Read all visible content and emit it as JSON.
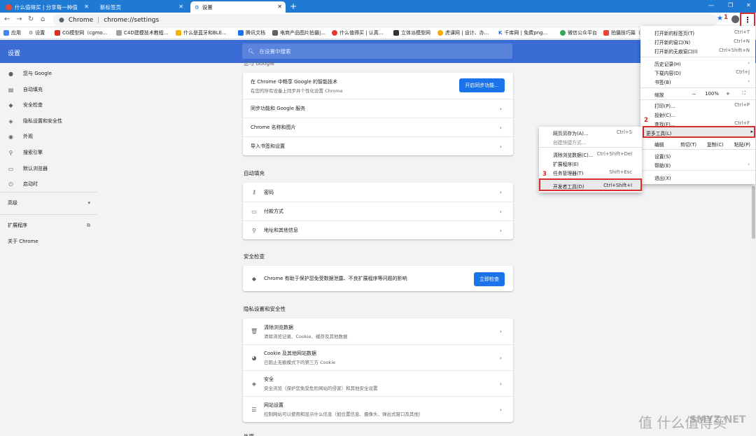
{
  "tabs": [
    {
      "title": "什么值得买 | 分享每一种值",
      "active": false
    },
    {
      "title": "新标签页",
      "active": false
    },
    {
      "title": "设置",
      "active": true
    }
  ],
  "window_controls": {
    "minimize": "—",
    "maximize": "❐",
    "close": "✕"
  },
  "omnibox": {
    "scheme": "Chrome",
    "url": "chrome://settings"
  },
  "annotations": {
    "a1": "1",
    "a2": "2",
    "a3": "3"
  },
  "bookmarks": [
    {
      "label": "应用",
      "color": "#4285f4"
    },
    {
      "label": "设置",
      "color": "#5f6368"
    },
    {
      "label": "CG模型网（cgmo...",
      "color": "#d93025"
    },
    {
      "label": "C4D建模技术教程...",
      "color": "#9aa0a6"
    },
    {
      "label": "什么是蓝牙和BLE...",
      "color": "#f4b400"
    },
    {
      "label": "腾讯文档",
      "color": "#1a73e8"
    },
    {
      "label": "电商产品图片拍摄|...",
      "color": "#5f6368"
    },
    {
      "label": "什么值得买 | 认真...",
      "color": "#e53935"
    },
    {
      "label": "立体派模型网",
      "color": "#333333"
    },
    {
      "label": "虎课网 | 设计、办...",
      "color": "#f9ab00"
    },
    {
      "label": "千库网 | 免费png...",
      "color": "#1a73e8"
    },
    {
      "label": "微信公众平台",
      "color": "#34a853"
    },
    {
      "label": "拍摄技巧篇（",
      "color": "#ea4335"
    }
  ],
  "app": {
    "title": "设置",
    "search_placeholder": "在设置中搜索"
  },
  "sidebar": {
    "items": [
      {
        "label": "您与 Google",
        "icon": "person-icon"
      },
      {
        "label": "自动填充",
        "icon": "clipboard-icon"
      },
      {
        "label": "安全检查",
        "icon": "shield-icon"
      },
      {
        "label": "隐私设置和安全性",
        "icon": "privacy-shield-icon"
      },
      {
        "label": "外观",
        "icon": "palette-icon"
      },
      {
        "label": "搜索引擎",
        "icon": "search-icon"
      },
      {
        "label": "默认浏览器",
        "icon": "browser-icon"
      },
      {
        "label": "启动时",
        "icon": "power-icon"
      }
    ],
    "advanced": "高级",
    "extensions": "扩展程序",
    "about": "关于 Chrome"
  },
  "sections": {
    "you_google_title": "您与 Google",
    "sync_title": "在 Chrome 中畅享 Google 的智能技术",
    "sync_sub": "在您的所有设备上同步并个性化设置 Chrome",
    "sync_button": "开启同步功能...",
    "sync_services": "同步功能和 Google 服务",
    "chrome_name": "Chrome 名称和图片",
    "import": "导入书签和设置",
    "autofill_title": "自动填充",
    "passwords": "密码",
    "payments": "付款方式",
    "addresses": "地址和其他信息",
    "safety_title": "安全检查",
    "safety_text": "Chrome 有助于保护您免受数据泄露、不良扩展程序等问题的影响",
    "safety_button": "立即检查",
    "privacy_title": "隐私设置和安全性",
    "clear_title": "清除浏览数据",
    "clear_sub": "清除浏览记录、Cookie、缓存及其他数据",
    "cookies_title": "Cookie 及其他网站数据",
    "cookies_sub": "已阻止无痕模式下的第三方 Cookie",
    "security_title": "安全",
    "security_sub": "安全浏览（保护您免受危险网站的侵害）和其他安全设置",
    "site_title": "网站设置",
    "site_sub": "控制网站可以使用和显示什么信息（如位置信息、摄像头、弹出式窗口及其他）",
    "next_title": "外观"
  },
  "menu": {
    "new_tab": "打开新的标签页(T)",
    "new_tab_sc": "Ctrl+T",
    "new_window": "打开新的窗口(N)",
    "new_window_sc": "Ctrl+N",
    "incognito": "打开新的无痕窗口(I)",
    "incognito_sc": "Ctrl+Shift+N",
    "history": "历史记录(H)",
    "downloads": "下载内容(D)",
    "downloads_sc": "Ctrl+J",
    "bookmarks": "书签(B)",
    "zoom": "缩放",
    "zoom_minus": "－",
    "zoom_value": "100%",
    "zoom_plus": "+",
    "print": "打印(P)...",
    "print_sc": "Ctrl+P",
    "cast": "投射(C)...",
    "find": "查找(F)...",
    "find_sc": "Ctrl+F",
    "more_tools": "更多工具(L)",
    "edit": "编辑",
    "cut": "剪切(T)",
    "copy": "复制(C)",
    "paste": "粘贴(P)",
    "settings": "设置(S)",
    "help": "帮助(E)",
    "exit": "退出(X)"
  },
  "submenu": {
    "save_as": "网页另存为(A)...",
    "save_as_sc": "Ctrl+S",
    "shortcut": "创建快捷方式...",
    "clear": "清除浏览数据(C)...",
    "clear_sc": "Ctrl+Shift+Del",
    "extensions": "扩展程序(E)",
    "task_manager": "任务管理器(T)",
    "task_manager_sc": "Shift+Esc",
    "devtools": "开发者工具(D)",
    "devtools_sc": "Ctrl+Shift+I"
  },
  "watermark": {
    "logo": "值 什么值得买",
    "site": "SMYZ.NET"
  }
}
